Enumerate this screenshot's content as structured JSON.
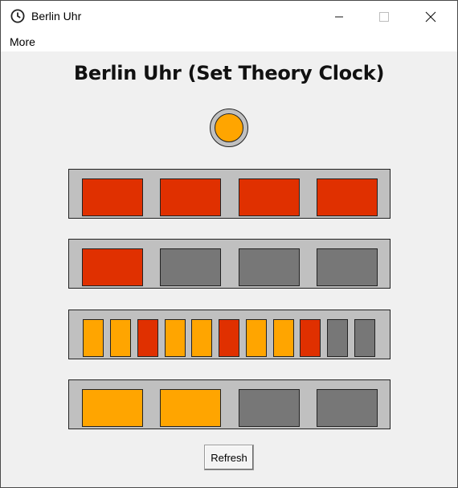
{
  "window": {
    "title": "Berlin Uhr"
  },
  "menu": {
    "items": [
      "More"
    ]
  },
  "heading": "Berlin Uhr (Set Theory Clock)",
  "colors": {
    "red": "#e03000",
    "yellow": "#ffa500",
    "off": "#777777",
    "panel": "#c0c0c0"
  },
  "clock": {
    "seconds_lamp": "on",
    "rows": [
      {
        "name": "five-hours",
        "lamps": [
          "red",
          "red",
          "red",
          "red"
        ]
      },
      {
        "name": "one-hour",
        "lamps": [
          "red",
          "off",
          "off",
          "off"
        ]
      },
      {
        "name": "five-minutes",
        "lamps": [
          "yellow",
          "yellow",
          "red",
          "yellow",
          "yellow",
          "red",
          "yellow",
          "yellow",
          "red",
          "off",
          "off"
        ]
      },
      {
        "name": "one-minute",
        "lamps": [
          "yellow",
          "yellow",
          "off",
          "off"
        ]
      }
    ]
  },
  "buttons": {
    "refresh": "Refresh"
  }
}
